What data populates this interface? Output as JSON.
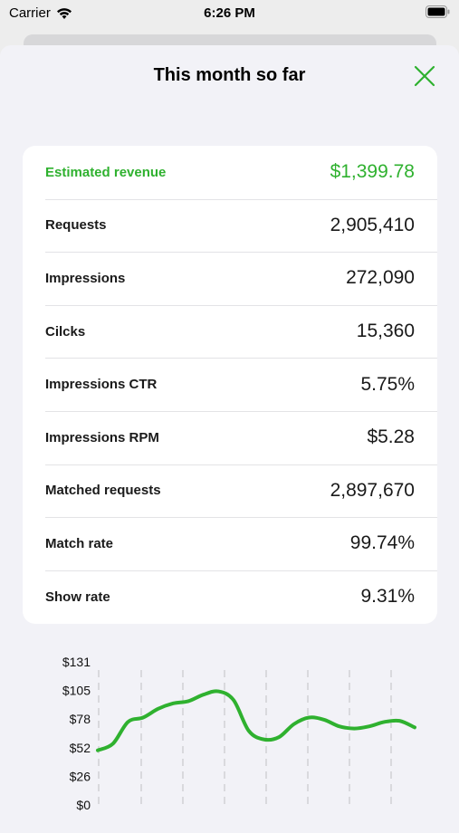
{
  "status_bar": {
    "carrier": "Carrier",
    "time": "6:26 PM"
  },
  "sheet": {
    "title": "This month so far"
  },
  "metrics": [
    {
      "label": "Estimated revenue",
      "value": "$1,399.78",
      "accent": true
    },
    {
      "label": "Requests",
      "value": "2,905,410"
    },
    {
      "label": "Impressions",
      "value": "272,090"
    },
    {
      "label": "Cilcks",
      "value": "15,360"
    },
    {
      "label": "Impressions CTR",
      "value": "5.75%"
    },
    {
      "label": "Impressions RPM",
      "value": "$5.28"
    },
    {
      "label": "Matched requests",
      "value": "2,897,670"
    },
    {
      "label": "Match rate",
      "value": "99.74%"
    },
    {
      "label": "Show rate",
      "value": "9.31%"
    }
  ],
  "colors": {
    "accent": "#2fb12f",
    "sheet_bg": "#f2f2f7"
  },
  "icons": {
    "close": "close-x-icon",
    "wifi": "wifi-icon",
    "battery": "battery-icon"
  },
  "chart_data": {
    "type": "line",
    "y_ticks": [
      "$131",
      "$105",
      "$78",
      "$52",
      "$26",
      "$0"
    ],
    "ylim": [
      0,
      131
    ],
    "series": [
      {
        "values": [
          50,
          56,
          76,
          80,
          88,
          93,
          95,
          101,
          104,
          96,
          68,
          60,
          62,
          74,
          80,
          78,
          72,
          70,
          72,
          76,
          77,
          71
        ]
      }
    ],
    "grid": "vertical dashed",
    "color": "#2fb12f"
  }
}
